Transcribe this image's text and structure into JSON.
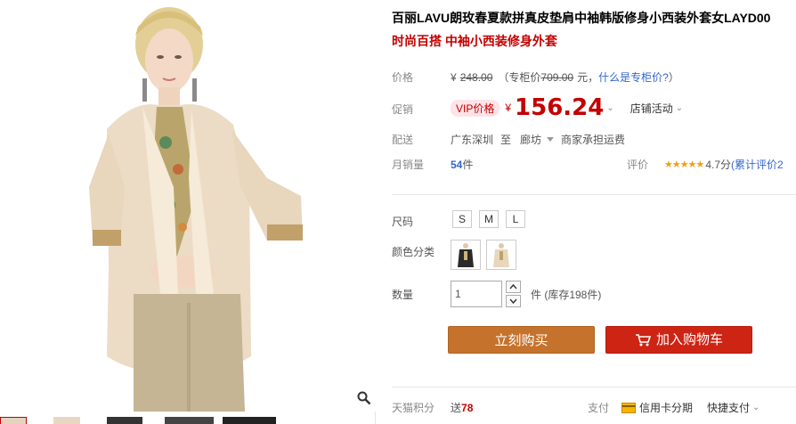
{
  "product": {
    "title": "百丽LAVU朗玫春夏款拼真皮垫肩中袖韩版修身小西装外套女LAYD00",
    "subtitle": "时尚百搭 中袖小西装修身外套"
  },
  "price": {
    "label": "价格",
    "currency": "¥",
    "original": "248.00",
    "counter_prefix": "（专柜价",
    "counter_value": "709.00",
    "counter_suffix": "元，",
    "counter_link": "什么是专柜价?",
    "close_paren": "）"
  },
  "promo": {
    "label": "促销",
    "badge": "VIP价格",
    "currency": "¥",
    "value": "156.24",
    "store_activity": "店铺活动"
  },
  "shipping": {
    "label": "配送",
    "from": "广东深圳",
    "to_word": "至",
    "to": "廊坊",
    "note": "商家承担运费"
  },
  "sales": {
    "label": "月销量",
    "count": "54",
    "unit": "件",
    "rating_label": "评价",
    "stars": "★★★★★",
    "score": "4.7分",
    "review_link": "(累计评价2"
  },
  "options": {
    "size_label": "尺码",
    "sizes": [
      "S",
      "M",
      "L"
    ],
    "color_label": "颜色分类",
    "qty_label": "数量",
    "qty_value": "1",
    "stock_text": "件 (库存198件)"
  },
  "actions": {
    "buy_now": "立刻购买",
    "add_cart": "加入购物车"
  },
  "footer": {
    "points_label": "天猫积分",
    "points_prefix": "送",
    "points_value": "78",
    "pay_label": "支付",
    "credit": "信用卡分期",
    "quick": "快捷支付"
  },
  "colors": {
    "accent_red": "#c40000",
    "buy_button": "#c5722c",
    "cart_button": "#cd2414",
    "link_blue": "#3366cc"
  },
  "icons": [
    "magnifier-icon",
    "cart-icon",
    "caret-down-icon",
    "chevron-down-icon",
    "stepper-up-icon",
    "stepper-down-icon",
    "credit-card-icon",
    "star-icon"
  ]
}
